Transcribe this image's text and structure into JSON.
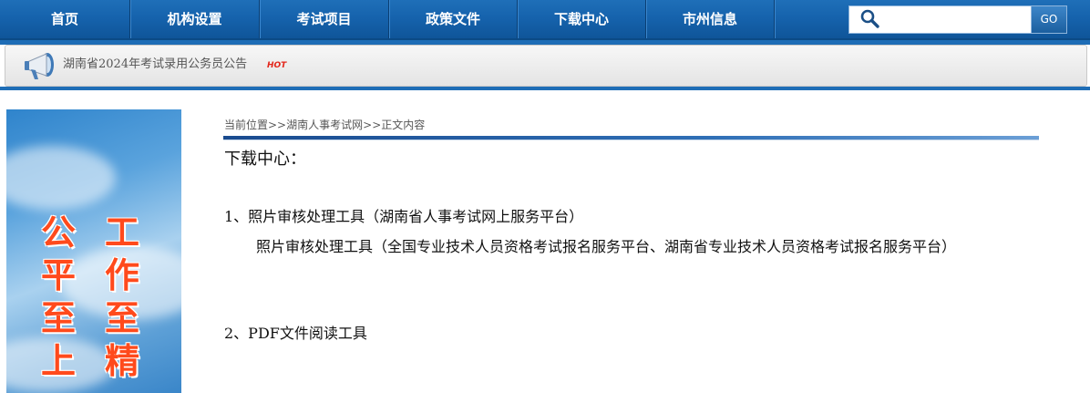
{
  "nav": {
    "items": [
      "首页",
      "机构设置",
      "考试项目",
      "政策文件",
      "下载中心",
      "市州信息"
    ],
    "search_placeholder": "",
    "go_label": "GO"
  },
  "notice": {
    "text": "湖南省2024年考试录用公务员公告",
    "badge": "HOT"
  },
  "banner": {
    "col1": [
      "公",
      "平",
      "至",
      "上"
    ],
    "col2": [
      "工",
      "作",
      "至",
      "精"
    ]
  },
  "breadcrumb": {
    "prefix": "当前位置>>",
    "link": "湖南人事考试网",
    "sep": ">>",
    "current": "正文内容"
  },
  "content": {
    "title": "下载中心：",
    "item1": "1、照片审核处理工具（湖南省人事考试网上服务平台）",
    "item1b": "照片审核处理工具（全国专业技术人员资格考试报名服务平台、湖南省专业技术人员资格考试报名服务平台）",
    "item2": "2、PDF文件阅读工具"
  },
  "colors": {
    "nav_bg": "#1663ad",
    "slogan": "#ff4a1c",
    "hot": "#e3261b"
  }
}
